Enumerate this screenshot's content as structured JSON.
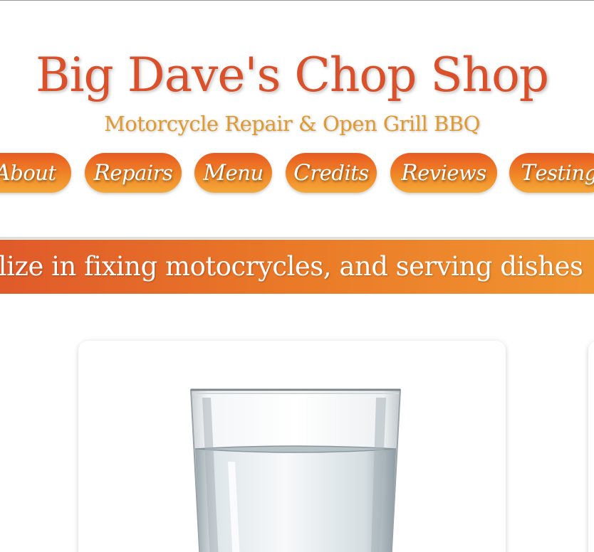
{
  "header": {
    "title": "Big Dave's Chop Shop",
    "subtitle": "Motorcycle Repair & Open Grill BBQ"
  },
  "nav": {
    "items": [
      {
        "label": "About"
      },
      {
        "label": "Repairs"
      },
      {
        "label": "Menu"
      },
      {
        "label": "Credits"
      },
      {
        "label": "Reviews"
      },
      {
        "label": "Testing"
      }
    ]
  },
  "banner": {
    "text": "We specilize in fixing motocrycles, and serving dishes"
  },
  "cards": [
    {
      "image_icon": "water-glass-image"
    }
  ],
  "colors": {
    "title": "#d9502a",
    "subtitle": "#e09a30",
    "accent": "#ea7a28"
  }
}
